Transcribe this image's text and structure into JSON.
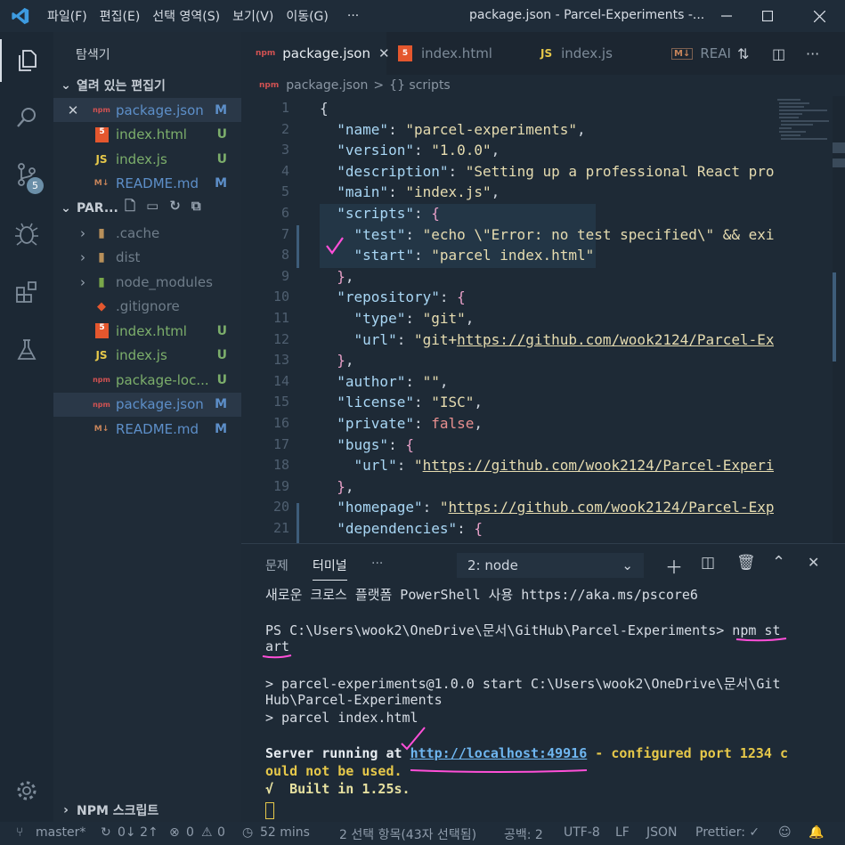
{
  "titlebar": {
    "menu": [
      "파일(F)",
      "편집(E)",
      "선택 영역(S)",
      "보기(V)",
      "이동(G)",
      "···"
    ],
    "title": "package.json - Parcel-Experiments -..."
  },
  "activity": {
    "scm_badge": "5"
  },
  "sidebar": {
    "header": "탐색기",
    "open_editors_label": "열려 있는 편집기",
    "open_editors": [
      {
        "name": "package.json",
        "status": "M",
        "icon": "npm-icon"
      },
      {
        "name": "index.html",
        "status": "U",
        "icon": "html5-icon"
      },
      {
        "name": "index.js",
        "status": "U",
        "icon": "js-icon"
      },
      {
        "name": "README.md",
        "status": "M",
        "icon": "markdown-icon"
      }
    ],
    "project_label": "PAR...",
    "tree": [
      {
        "name": ".cache",
        "status": "",
        "icon": "folder-icon"
      },
      {
        "name": "dist",
        "status": "",
        "icon": "folder-icon"
      },
      {
        "name": "node_modules",
        "status": "",
        "icon": "folder-node-icon"
      },
      {
        "name": ".gitignore",
        "status": "",
        "icon": "git-icon"
      },
      {
        "name": "index.html",
        "status": "U",
        "icon": "html5-icon"
      },
      {
        "name": "index.js",
        "status": "U",
        "icon": "js-icon"
      },
      {
        "name": "package-loc...",
        "status": "U",
        "icon": "npm-icon"
      },
      {
        "name": "package.json",
        "status": "M",
        "icon": "npm-icon"
      },
      {
        "name": "README.md",
        "status": "M",
        "icon": "markdown-icon"
      }
    ],
    "npm_scripts_label": "NPM 스크립트"
  },
  "tabs": [
    {
      "label": "package.json",
      "icon_text": "npm",
      "active": true
    },
    {
      "label": "index.html",
      "icon_text": "5",
      "active": false
    },
    {
      "label": "index.js",
      "icon_text": "JS",
      "active": false
    },
    {
      "label": "REAI",
      "icon_text": "M↓",
      "active": false
    }
  ],
  "breadcrumb": {
    "file": "package.json",
    "sep": ">",
    "node": "{} scripts"
  },
  "editor": {
    "lines": [
      {
        "n": "1",
        "html": "<span class='p'>{</span>"
      },
      {
        "n": "2",
        "html": "  <span class='k'>\"name\"</span><span class='p'>: </span><span class='s'>\"parcel-experiments\"</span><span class='p'>,</span>"
      },
      {
        "n": "3",
        "html": "  <span class='k'>\"version\"</span><span class='p'>: </span><span class='s'>\"1.0.0\"</span><span class='p'>,</span>"
      },
      {
        "n": "4",
        "html": "  <span class='k'>\"description\"</span><span class='p'>: </span><span class='s'>\"Setting up a professional React pro</span>"
      },
      {
        "n": "5",
        "html": "  <span class='k'>\"main\"</span><span class='p'>: </span><span class='s'>\"index.js\"</span><span class='p'>,</span>"
      },
      {
        "n": "6",
        "html": "  <span class='k'>\"scripts\"</span><span class='p'>: </span><span class='b'>{</span>"
      },
      {
        "n": "7",
        "html": "    <span class='k'>\"test\"</span><span class='p'>: </span><span class='s'>\"echo \\\"Error: no test specified\\\" &amp;&amp; exi</span>"
      },
      {
        "n": "8",
        "html": "    <span class='k'>\"start\"</span><span class='p'>: </span><span class='s'>\"parcel index.html\"</span>"
      },
      {
        "n": "9",
        "html": "  <span class='b'>}</span><span class='p'>,</span>"
      },
      {
        "n": "10",
        "html": "  <span class='k'>\"repository\"</span><span class='p'>: </span><span class='b'>{</span>"
      },
      {
        "n": "11",
        "html": "    <span class='k'>\"type\"</span><span class='p'>: </span><span class='s'>\"git\"</span><span class='p'>,</span>"
      },
      {
        "n": "12",
        "html": "    <span class='k'>\"url\"</span><span class='p'>: </span><span class='s'>\"git+</span><span class='u'>https://github.com/wook2124/Parcel-Ex</span>"
      },
      {
        "n": "13",
        "html": "  <span class='b'>}</span><span class='p'>,</span>"
      },
      {
        "n": "14",
        "html": "  <span class='k'>\"author\"</span><span class='p'>: </span><span class='s'>\"\"</span><span class='p'>,</span>"
      },
      {
        "n": "15",
        "html": "  <span class='k'>\"license\"</span><span class='p'>: </span><span class='s'>\"ISC\"</span><span class='p'>,</span>"
      },
      {
        "n": "16",
        "html": "  <span class='k'>\"private\"</span><span class='p'>: </span><span class='kw'>false</span><span class='p'>,</span>"
      },
      {
        "n": "17",
        "html": "  <span class='k'>\"bugs\"</span><span class='p'>: </span><span class='b'>{</span>"
      },
      {
        "n": "18",
        "html": "    <span class='k'>\"url\"</span><span class='p'>: </span><span class='s'>\"</span><span class='u'>https://github.com/wook2124/Parcel-Experi</span>"
      },
      {
        "n": "19",
        "html": "  <span class='b'>}</span><span class='p'>,</span>"
      },
      {
        "n": "20",
        "html": "  <span class='k'>\"homepage\"</span><span class='p'>: </span><span class='s'>\"</span><span class='u'>https://github.com/wook2124/Parcel-Exp</span>"
      },
      {
        "n": "21",
        "html": "  <span class='k'>\"dependencies\"</span><span class='p'>: </span><span class='b'>{</span>"
      }
    ]
  },
  "panel": {
    "tabs": [
      "문제",
      "터미널",
      "···"
    ],
    "terminal_select": "2: node",
    "terminal": [
      {
        "text": "새로운 크로스 플랫폼 PowerShell 사용 https://aka.ms/pscore6",
        "style": "normal"
      },
      {
        "text": "",
        "style": "normal"
      },
      {
        "text": "PS C:\\Users\\wook2\\OneDrive\\문서\\GitHub\\Parcel-Experiments> npm st",
        "style": "normal"
      },
      {
        "text": "art",
        "style": "normal"
      },
      {
        "text": "",
        "style": "normal"
      },
      {
        "text": "> parcel-experiments@1.0.0 start C:\\Users\\wook2\\OneDrive\\문서\\Git",
        "style": "normal"
      },
      {
        "text": "Hub\\Parcel-Experiments",
        "style": "normal"
      },
      {
        "text": "> parcel index.html",
        "style": "normal"
      },
      {
        "text": "",
        "style": "normal"
      },
      {
        "text": "Server running at http://localhost:49916 - configured port 1234 c",
        "style": "server"
      },
      {
        "text": "ould not be used.",
        "style": "warn"
      },
      {
        "text": "√  Built in 1.25s.",
        "style": "ok"
      }
    ]
  },
  "status": {
    "branch": "master*",
    "sync": "0↓ 2↑",
    "errors": "0",
    "warnings": "0",
    "time": "52 mins",
    "selection": "2 선택 항목(43자 선택됨)",
    "spaces": "공백: 2",
    "encoding": "UTF-8",
    "eol": "LF",
    "language": "JSON",
    "prettier": "Prettier: ✓"
  }
}
